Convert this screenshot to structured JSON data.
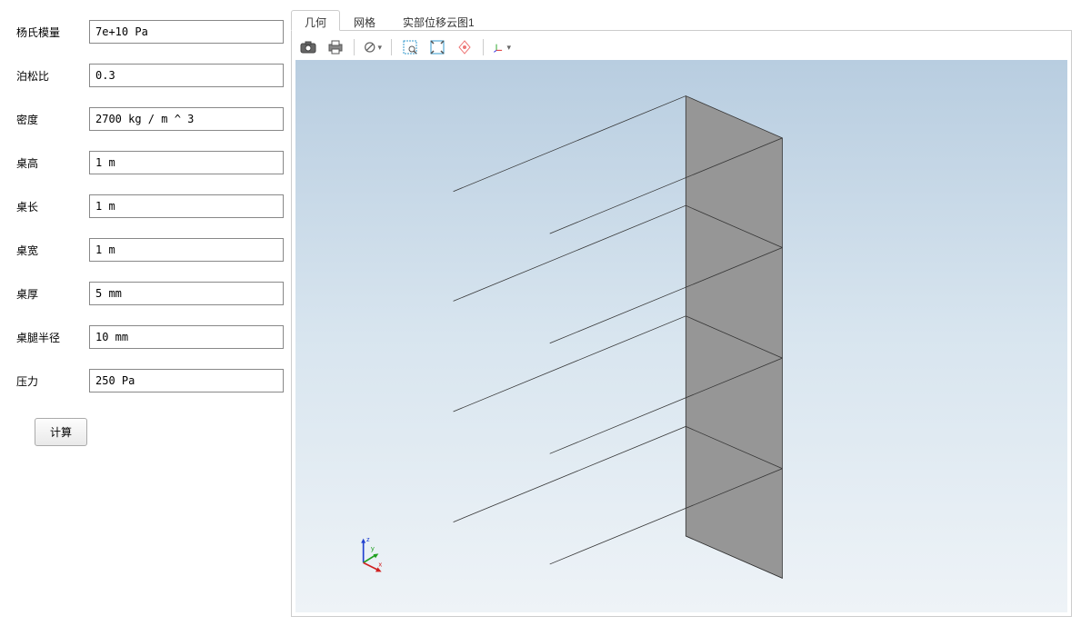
{
  "form": {
    "fields": [
      {
        "label": "杨氏模量",
        "value": "7e+10 Pa"
      },
      {
        "label": "泊松比",
        "value": "0.3"
      },
      {
        "label": "密度",
        "value": "2700 kg / m ^ 3"
      },
      {
        "label": "桌高",
        "value": "1 m"
      },
      {
        "label": "桌长",
        "value": "1 m"
      },
      {
        "label": "桌宽",
        "value": "1 m"
      },
      {
        "label": "桌厚",
        "value": "5 mm"
      },
      {
        "label": "桌腿半径",
        "value": "10 mm"
      },
      {
        "label": "压力",
        "value": "250 Pa"
      }
    ],
    "compute_label": "计算"
  },
  "tabs": [
    {
      "label": "几何",
      "active": true
    },
    {
      "label": "网格",
      "active": false
    },
    {
      "label": "实部位移云图1",
      "active": false
    }
  ],
  "toolbar": {
    "icons": [
      {
        "name": "camera-icon"
      },
      {
        "name": "print-icon"
      },
      {
        "name": "sep"
      },
      {
        "name": "reset-icon",
        "dropdown": true
      },
      {
        "name": "sep"
      },
      {
        "name": "zoom-select-icon"
      },
      {
        "name": "fit-icon"
      },
      {
        "name": "rotate-icon"
      },
      {
        "name": "sep"
      },
      {
        "name": "axes-icon",
        "dropdown": true
      }
    ]
  },
  "axis_labels": {
    "x": "x",
    "y": "y",
    "z": "z"
  }
}
